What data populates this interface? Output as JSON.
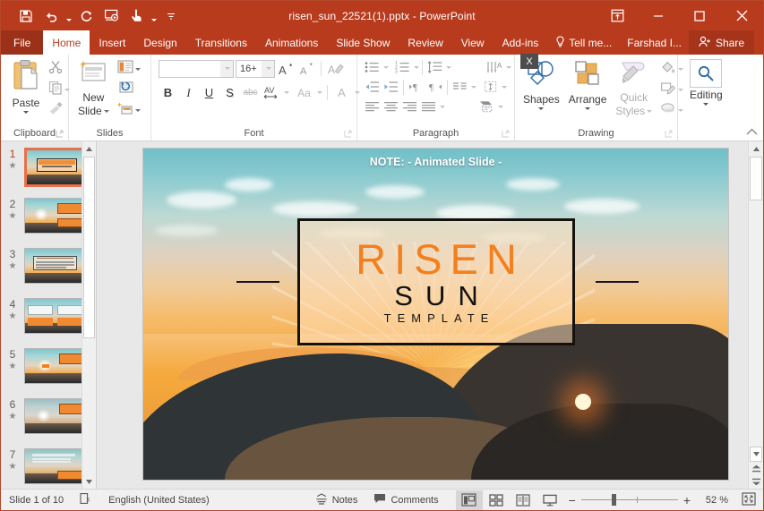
{
  "window": {
    "title": "risen_sun_22521(1).pptx - PowerPoint",
    "accent_color": "#b83b1e",
    "file_tab_color": "#9b3119",
    "quick_access": [
      {
        "name": "save",
        "label": "Save"
      },
      {
        "name": "undo",
        "label": "Undo"
      },
      {
        "name": "redo",
        "label": "Redo"
      },
      {
        "name": "start-from-beginning",
        "label": "Start From Beginning"
      },
      {
        "name": "touch-mouse-mode",
        "label": "Touch/Mouse Mode"
      },
      {
        "name": "customize-quick-access-toolbar",
        "label": "Customize Quick Access Toolbar"
      }
    ],
    "controls": {
      "ribbon_display": "Ribbon Display Options",
      "minimize": "Minimize",
      "restore": "Restore Down",
      "close": "Close"
    }
  },
  "tabs": [
    {
      "label": "File",
      "active": false,
      "file": true
    },
    {
      "label": "Home",
      "active": true
    },
    {
      "label": "Insert",
      "active": false
    },
    {
      "label": "Design",
      "active": false
    },
    {
      "label": "Transitions",
      "active": false
    },
    {
      "label": "Animations",
      "active": false
    },
    {
      "label": "Slide Show",
      "active": false
    },
    {
      "label": "Review",
      "active": false
    },
    {
      "label": "View",
      "active": false
    },
    {
      "label": "Add-ins",
      "active": false
    }
  ],
  "tellme": "Tell me...",
  "account": "Farshad I...",
  "share": "Share",
  "ribbon": {
    "collapse_label": "Collapse the Ribbon",
    "overlay_badge": "X",
    "groups": {
      "clipboard": {
        "label": "Clipboard",
        "paste": "Paste",
        "cut": "Cut",
        "copy": "Copy",
        "format_painter": "Format Painter"
      },
      "slides": {
        "label": "Slides",
        "new_slide": "New\nSlide",
        "new_slide_line1": "New",
        "new_slide_line2": "Slide",
        "layout": "Layout",
        "reset": "Reset",
        "section": "Section"
      },
      "font": {
        "label": "Font",
        "font_name_value": "",
        "font_name_placeholder": "",
        "font_size_value": "16+",
        "increase_font": "A",
        "decrease_font": "A",
        "clear_formatting": "Clear All Formatting",
        "bold": "B",
        "italic": "I",
        "underline": "U",
        "shadow": "S",
        "strikethrough": "abc",
        "character_spacing": "AV",
        "change_case": "Aa",
        "font_color": "A"
      },
      "paragraph": {
        "label": "Paragraph",
        "bullets": "Bullets",
        "numbering": "Numbering",
        "line_spacing": "Line Spacing",
        "text_direction": "Text Direction",
        "decrease_indent": "Decrease List Level",
        "increase_indent": "Increase List Level",
        "ltr": "Left-to-Right",
        "rtl": "Right-to-Left",
        "align_text": "Align Text",
        "align_left": "Align Left",
        "center": "Center",
        "align_right": "Align Right",
        "justify": "Justify",
        "columns": "Columns",
        "convert_smartart": "Convert to SmartArt"
      },
      "drawing": {
        "label": "Drawing",
        "shapes": "Shapes",
        "arrange": "Arrange",
        "quick_styles_line1": "Quick",
        "quick_styles_line2": "Styles",
        "shape_fill": "Shape Fill",
        "shape_outline": "Shape Outline",
        "shape_effects": "Shape Effects"
      },
      "editing": {
        "label": "",
        "editing": "Editing"
      }
    }
  },
  "thumbnails": [
    {
      "number": "1",
      "animated": true,
      "selected": true
    },
    {
      "number": "2",
      "animated": true,
      "selected": false
    },
    {
      "number": "3",
      "animated": true,
      "selected": false
    },
    {
      "number": "4",
      "animated": true,
      "selected": false
    },
    {
      "number": "5",
      "animated": true,
      "selected": false
    },
    {
      "number": "6",
      "animated": true,
      "selected": false
    },
    {
      "number": "7",
      "animated": true,
      "selected": false
    }
  ],
  "slide": {
    "note": "NOTE: - Animated Slide -",
    "title_main": "RISEN",
    "title_sub": "SUN",
    "title_tag": "TEMPLATE",
    "title_color": "#f4801d",
    "subtitle_color": "#111111"
  },
  "status": {
    "slide_counter": "Slide 1 of 10",
    "spelling": "Spell Check",
    "language": "English (United States)",
    "notes": "Notes",
    "comments": "Comments",
    "views": [
      {
        "name": "normal-view",
        "label": "Normal",
        "active": true
      },
      {
        "name": "slide-sorter-view",
        "label": "Slide Sorter",
        "active": false
      },
      {
        "name": "reading-view",
        "label": "Reading View",
        "active": false
      },
      {
        "name": "slide-show-view",
        "label": "Slide Show",
        "active": false
      }
    ],
    "zoom_out": "−",
    "zoom_in": "+",
    "zoom_value": "52 %",
    "fit_to_window": "Fit slide to current window"
  }
}
